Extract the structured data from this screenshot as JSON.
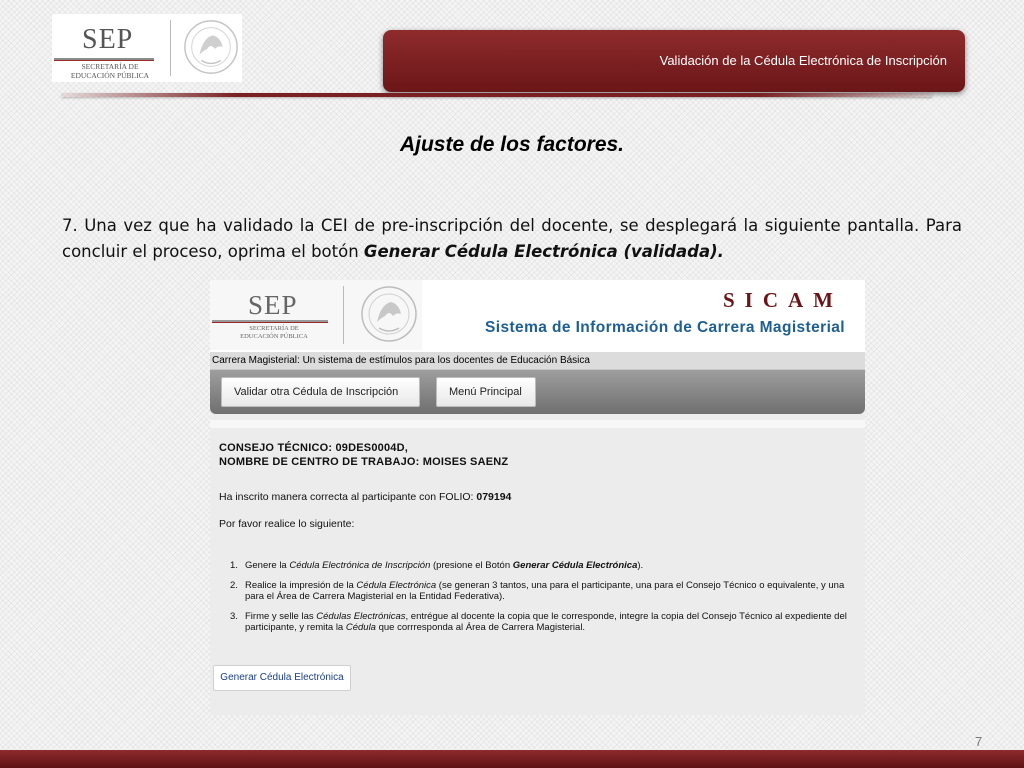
{
  "header": {
    "logo_abbr": "SEP",
    "logo_sub_line1": "SECRETARÍA DE",
    "logo_sub_line2": "EDUCACIÓN PÚBLICA",
    "title": "Validación de la Cédula Electrónica de Inscripción",
    "brand_color": "#7a2023"
  },
  "slide": {
    "heading": "Ajuste de los factores.",
    "paragraph_text": "7. Una vez que ha validado la CEI de pre-inscripción del docente, se desplegará la siguiente pantalla. Para concluir el proceso, oprima el botón ",
    "paragraph_emphasis": "Generar Cédula Electrónica (validada).",
    "page_number": "7"
  },
  "screenshot": {
    "logo_abbr": "SEP",
    "logo_sub_line1": "SECRETARÍA DE",
    "logo_sub_line2": "EDUCACIÓN PÚBLICA",
    "app_code": "SICAM",
    "app_name": "Sistema de Información de Carrera Magisterial",
    "tagline": "Carrera Magisterial: Un sistema de estímulos para los docentes de Educación Básica",
    "nav": {
      "validate_btn": "Validar otra Cédula de Inscripción",
      "menu_btn": "Menú Principal"
    },
    "consejo": "CONSEJO TÉCNICO: 09DES0004D,",
    "centro": "NOMBRE DE CENTRO DE TRABAJO: MOISES SAENZ",
    "success_prefix": "Ha inscrito manera correcta al participante con FOLIO: ",
    "folio": "079194",
    "instruction": "Por favor realice lo siguiente:",
    "steps": [
      {
        "num": "1.",
        "a": "Genere la ",
        "b": "Cédula Electrónica de Inscripción",
        "c": " (presione el Botón ",
        "d": "Generar Cédula Electrónica",
        "e": ")."
      },
      {
        "num": "2.",
        "a": "Realice la impresión de la ",
        "b": "Cédula Electrónica",
        "c": " (se generan 3 tantos, una para el participante, una para el Consejo Técnico o equivalente, y una para el Área de Carrera Magisterial en la Entidad Federativa)."
      },
      {
        "num": "3.",
        "a": "Firme y selle las ",
        "b": "Cédulas Electrónicas",
        "c": ", entrégue al docente la copia que le corresponde, integre la copia del Consejo Técnico al expediente del participante, y remita la ",
        "d": "Cédula",
        "e": " que corrresponda al Área de Carrera Magisterial."
      }
    ],
    "generate_btn": "Generar Cédula Electrónica"
  },
  "icons": {
    "seal": "mexico-coat-of-arms-icon"
  }
}
